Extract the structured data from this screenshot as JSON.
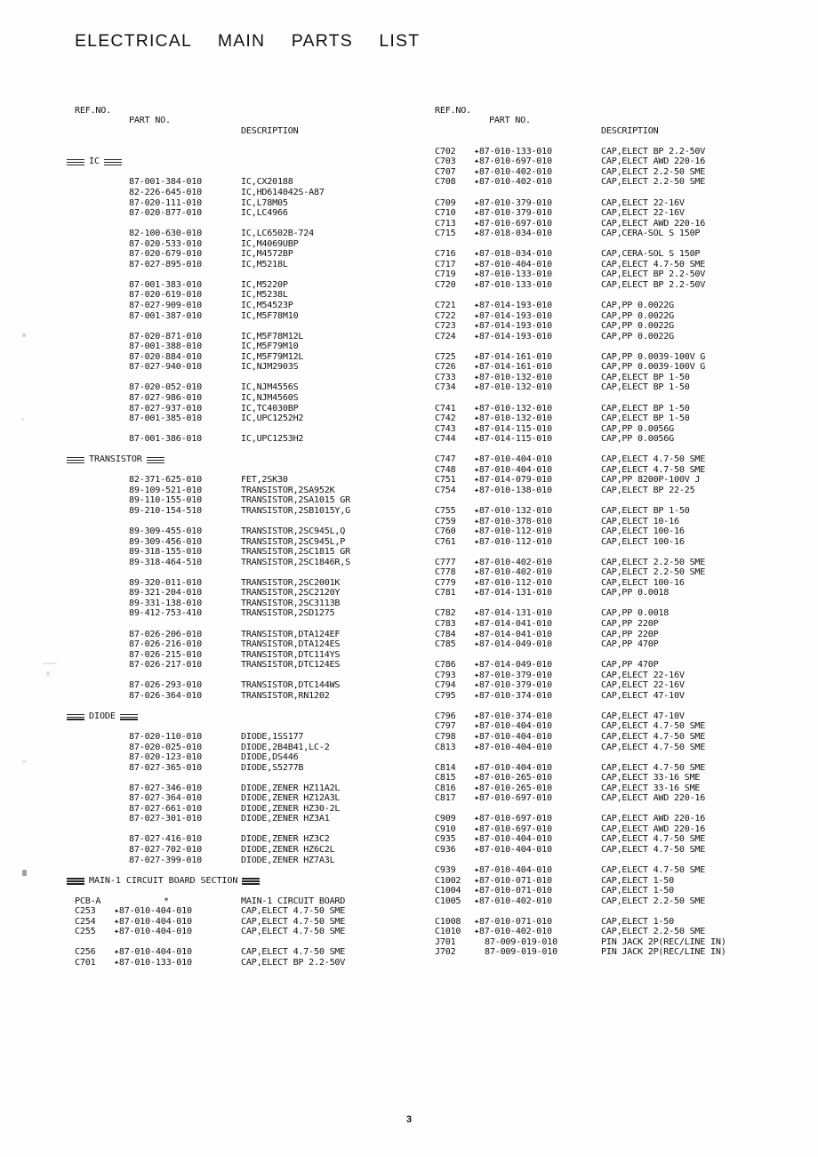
{
  "document": {
    "title": "ELECTRICAL  MAIN  PARTS  LIST",
    "page_number": "3"
  },
  "columns": {
    "headers": {
      "ref_no": "REF.NO.",
      "part_no": "PART NO.",
      "description": "DESCRIPTION"
    }
  },
  "left_column": {
    "blocks": [
      {
        "type": "section",
        "label": "IC"
      },
      {
        "type": "gap"
      },
      {
        "type": "rows",
        "rows": [
          {
            "ref": "",
            "part": "87-001-384-010",
            "desc": "IC,CX20188"
          },
          {
            "ref": "",
            "part": "82-226-645-010",
            "desc": "IC,HD614042S-A87"
          },
          {
            "ref": "",
            "part": "87-020-111-010",
            "desc": "IC,L78M05"
          },
          {
            "ref": "",
            "part": "87-020-877-010",
            "desc": "IC,LC4966"
          }
        ]
      },
      {
        "type": "gap"
      },
      {
        "type": "rows",
        "rows": [
          {
            "ref": "",
            "part": "82-100-630-010",
            "desc": "IC,LC6502B-724"
          },
          {
            "ref": "",
            "part": "87-020-533-010",
            "desc": "IC,M4069UBP"
          },
          {
            "ref": "",
            "part": "87-020-679-010",
            "desc": "IC,M4572BP"
          },
          {
            "ref": "",
            "part": "87-027-895-010",
            "desc": "IC,M5218L"
          }
        ]
      },
      {
        "type": "gap"
      },
      {
        "type": "rows",
        "rows": [
          {
            "ref": "",
            "part": "87-001-383-010",
            "desc": "IC,M5220P"
          },
          {
            "ref": "",
            "part": "87-020-619-010",
            "desc": "IC,M5238L"
          },
          {
            "ref": "",
            "part": "87-027-909-010",
            "desc": "IC,M54523P"
          },
          {
            "ref": "",
            "part": "87-001-387-010",
            "desc": "IC,M5F78M10"
          }
        ]
      },
      {
        "type": "gap"
      },
      {
        "type": "rows",
        "rows": [
          {
            "ref": "",
            "part": "87-020-871-010",
            "desc": "IC,M5F78M12L"
          },
          {
            "ref": "",
            "part": "87-001-388-010",
            "desc": "IC,M5F79M10"
          },
          {
            "ref": "",
            "part": "87-020-884-010",
            "desc": "IC,M5F79M12L"
          },
          {
            "ref": "",
            "part": "87-027-940-010",
            "desc": "IC,NJM2903S"
          }
        ]
      },
      {
        "type": "gap"
      },
      {
        "type": "rows",
        "rows": [
          {
            "ref": "",
            "part": "87-020-052-010",
            "desc": "IC,NJM4556S"
          },
          {
            "ref": "",
            "part": "87-027-986-010",
            "desc": "IC,NJM4560S"
          },
          {
            "ref": "",
            "part": "87-027-937-010",
            "desc": "IC,TC4030BP"
          },
          {
            "ref": "",
            "part": "87-001-385-010",
            "desc": "IC,UPC1252H2"
          }
        ]
      },
      {
        "type": "gap"
      },
      {
        "type": "rows",
        "rows": [
          {
            "ref": "",
            "part": "87-001-386-010",
            "desc": "IC,UPC1253H2"
          }
        ]
      },
      {
        "type": "gap"
      },
      {
        "type": "section",
        "label": "TRANSISTOR"
      },
      {
        "type": "gap"
      },
      {
        "type": "rows",
        "rows": [
          {
            "ref": "",
            "part": "82-371-625-010",
            "desc": "FET,2SK30"
          },
          {
            "ref": "",
            "part": "89-109-521-010",
            "desc": "TRANSISTOR,2SA952K"
          },
          {
            "ref": "",
            "part": "89-110-155-010",
            "desc": "TRANSISTOR,2SA1015 GR"
          },
          {
            "ref": "",
            "part": "89-210-154-510",
            "desc": "TRANSISTOR,2SB1015Y,G"
          }
        ]
      },
      {
        "type": "gap"
      },
      {
        "type": "rows",
        "rows": [
          {
            "ref": "",
            "part": "89-309-455-010",
            "desc": "TRANSISTOR,2SC945L,Q"
          },
          {
            "ref": "",
            "part": "89-309-456-010",
            "desc": "TRANSISTOR,2SC945L,P"
          },
          {
            "ref": "",
            "part": "89-318-155-010",
            "desc": "TRANSISTOR,2SC1815 GR"
          },
          {
            "ref": "",
            "part": "89-318-464-510",
            "desc": "TRANSISTOR,2SC1846R,S"
          }
        ]
      },
      {
        "type": "gap"
      },
      {
        "type": "rows",
        "rows": [
          {
            "ref": "",
            "part": "89-320-011-010",
            "desc": "TRANSISTOR,2SC2001K"
          },
          {
            "ref": "",
            "part": "89-321-204-010",
            "desc": "TRANSISTOR,2SC2120Y"
          },
          {
            "ref": "",
            "part": "89-331-138-010",
            "desc": "TRANSISTOR,2SC3113B"
          },
          {
            "ref": "",
            "part": "89-412-753-410",
            "desc": "TRANSISTOR,2SD1275"
          }
        ]
      },
      {
        "type": "gap"
      },
      {
        "type": "rows",
        "rows": [
          {
            "ref": "",
            "part": "87-026-206-010",
            "desc": "TRANSISTOR,DTA124EF"
          },
          {
            "ref": "",
            "part": "87-026-216-010",
            "desc": "TRANSISTOR,DTA124ES"
          },
          {
            "ref": "",
            "part": "87-026-215-010",
            "desc": "TRANSISTOR,DTC114YS"
          },
          {
            "ref": "",
            "part": "87-026-217-010",
            "desc": "TRANSISTOR,DTC124ES"
          }
        ]
      },
      {
        "type": "gap"
      },
      {
        "type": "rows",
        "rows": [
          {
            "ref": "",
            "part": "87-026-293-010",
            "desc": "TRANSISTOR,DTC144WS"
          },
          {
            "ref": "",
            "part": "87-026-364-010",
            "desc": "TRANSISTOR,RN1202"
          }
        ]
      },
      {
        "type": "gap"
      },
      {
        "type": "section",
        "label": "DIODE"
      },
      {
        "type": "gap"
      },
      {
        "type": "rows",
        "rows": [
          {
            "ref": "",
            "part": "87-020-110-010",
            "desc": "DIODE,1SS177"
          },
          {
            "ref": "",
            "part": "87-020-025-010",
            "desc": "DIODE,2B4B41,LC-2"
          },
          {
            "ref": "",
            "part": "87-020-123-010",
            "desc": "DIODE,DS446"
          },
          {
            "ref": "",
            "part": "87-027-365-010",
            "desc": "DIODE,S5277B"
          }
        ]
      },
      {
        "type": "gap"
      },
      {
        "type": "rows",
        "rows": [
          {
            "ref": "",
            "part": "87-027-346-010",
            "desc": "DIODE,ZENER HZ11A2L"
          },
          {
            "ref": "",
            "part": "87-027-364-010",
            "desc": "DIODE,ZENER HZ12A3L"
          },
          {
            "ref": "",
            "part": "87-027-661-010",
            "desc": "DIODE,ZENER HZ30-2L"
          },
          {
            "ref": "",
            "part": "87-027-301-010",
            "desc": "DIODE,ZENER HZ3A1"
          }
        ]
      },
      {
        "type": "gap"
      },
      {
        "type": "rows",
        "rows": [
          {
            "ref": "",
            "part": "87-027-416-010",
            "desc": "DIODE,ZENER HZ3C2"
          },
          {
            "ref": "",
            "part": "87-027-702-010",
            "desc": "DIODE,ZENER HZ6C2L"
          },
          {
            "ref": "",
            "part": "87-027-399-010",
            "desc": "DIODE,ZENER HZ7A3L"
          }
        ]
      },
      {
        "type": "gap"
      },
      {
        "type": "section",
        "label": "MAIN-1 CIRCUIT BOARD SECTION"
      },
      {
        "type": "gap"
      },
      {
        "type": "rows",
        "rows": [
          {
            "ref": "PCB-A",
            "part": "*",
            "desc": "MAIN-1 CIRCUIT BOARD",
            "part_center": true
          },
          {
            "ref": "C253",
            "part": "✦87-010-404-010",
            "desc": "CAP,ELECT 4.7-50 SME"
          },
          {
            "ref": "C254",
            "part": "✦87-010-404-010",
            "desc": "CAP,ELECT 4.7-50 SME"
          },
          {
            "ref": "C255",
            "part": "✦87-010-404-010",
            "desc": "CAP,ELECT 4.7-50 SME"
          }
        ]
      },
      {
        "type": "gap"
      },
      {
        "type": "rows",
        "rows": [
          {
            "ref": "C256",
            "part": "✦87-010-404-010",
            "desc": "CAP,ELECT 4.7-50 SME"
          },
          {
            "ref": "C701",
            "part": "✦87-010-133-010",
            "desc": "CAP,ELECT BP 2.2-50V"
          }
        ]
      }
    ]
  },
  "right_column": {
    "blocks": [
      {
        "type": "gap"
      },
      {
        "type": "gap"
      },
      {
        "type": "rows",
        "rows": [
          {
            "ref": "C702",
            "part": "✦87-010-133-010",
            "desc": "CAP,ELECT BP 2.2-50V"
          },
          {
            "ref": "C703",
            "part": "✦87-010-697-010",
            "desc": "CAP,ELECT AWD 220-16"
          },
          {
            "ref": "C707",
            "part": "✦87-010-402-010",
            "desc": "CAP,ELECT 2.2-50 SME"
          },
          {
            "ref": "C708",
            "part": "✦87-010-402-010",
            "desc": "CAP,ELECT 2.2-50 SME"
          }
        ]
      },
      {
        "type": "gap"
      },
      {
        "type": "rows",
        "rows": [
          {
            "ref": "C709",
            "part": "✦87-010-379-010",
            "desc": "CAP,ELECT 22-16V"
          },
          {
            "ref": "C710",
            "part": "✦87-010-379-010",
            "desc": "CAP,ELECT 22-16V"
          },
          {
            "ref": "C713",
            "part": "✦87-010-697-010",
            "desc": "CAP,ELECT AWD 220-16"
          },
          {
            "ref": "C715",
            "part": "✦87-018-034-010",
            "desc": "CAP,CERA-SOL S 150P"
          }
        ]
      },
      {
        "type": "gap"
      },
      {
        "type": "rows",
        "rows": [
          {
            "ref": "C716",
            "part": "✦87-018-034-010",
            "desc": "CAP,CERA-SOL S 150P"
          },
          {
            "ref": "C717",
            "part": "✦87-010-404-010",
            "desc": "CAP,ELECT 4.7-50 SME"
          },
          {
            "ref": "C719",
            "part": "✦87-010-133-010",
            "desc": "CAP,ELECT BP 2.2-50V"
          },
          {
            "ref": "C720",
            "part": "✦87-010-133-010",
            "desc": "CAP,ELECT BP 2.2-50V"
          }
        ]
      },
      {
        "type": "gap"
      },
      {
        "type": "rows",
        "rows": [
          {
            "ref": "C721",
            "part": "✦87-014-193-010",
            "desc": "CAP,PP 0.0022G"
          },
          {
            "ref": "C722",
            "part": "✦87-014-193-010",
            "desc": "CAP,PP 0.0022G"
          },
          {
            "ref": "C723",
            "part": "✦87-014-193-010",
            "desc": "CAP,PP 0.0022G"
          },
          {
            "ref": "C724",
            "part": "✦87-014-193-010",
            "desc": "CAP,PP 0.0022G"
          }
        ]
      },
      {
        "type": "gap"
      },
      {
        "type": "rows",
        "rows": [
          {
            "ref": "C725",
            "part": "✦87-014-161-010",
            "desc": "CAP,PP 0.0039-100V G"
          },
          {
            "ref": "C726",
            "part": "✦87-014-161-010",
            "desc": "CAP,PP 0.0039-100V G"
          },
          {
            "ref": "C733",
            "part": "✦87-010-132-010",
            "desc": "CAP,ELECT BP 1-50"
          },
          {
            "ref": "C734",
            "part": "✦87-010-132-010",
            "desc": "CAP,ELECT BP 1-50"
          }
        ]
      },
      {
        "type": "gap"
      },
      {
        "type": "rows",
        "rows": [
          {
            "ref": "C741",
            "part": "✦87-010-132-010",
            "desc": "CAP,ELECT BP 1-50"
          },
          {
            "ref": "C742",
            "part": "✦87-010-132-010",
            "desc": "CAP,ELECT BP 1-50"
          },
          {
            "ref": "C743",
            "part": "✦87-014-115-010",
            "desc": "CAP,PP 0.0056G"
          },
          {
            "ref": "C744",
            "part": "✦87-014-115-010",
            "desc": "CAP,PP 0.0056G"
          }
        ]
      },
      {
        "type": "gap"
      },
      {
        "type": "rows",
        "rows": [
          {
            "ref": "C747",
            "part": "✦87-010-404-010",
            "desc": "CAP,ELECT 4.7-50 SME"
          },
          {
            "ref": "C748",
            "part": "✦87-010-404-010",
            "desc": "CAP,ELECT 4.7-50 SME"
          },
          {
            "ref": "C751",
            "part": "✦87-014-079-010",
            "desc": "CAP,PP 8200P-100V J"
          },
          {
            "ref": "C754",
            "part": "✦87-010-138-010",
            "desc": "CAP,ELECT BP 22-25"
          }
        ]
      },
      {
        "type": "gap"
      },
      {
        "type": "rows",
        "rows": [
          {
            "ref": "C755",
            "part": "✦87-010-132-010",
            "desc": "CAP,ELECT BP 1-50"
          },
          {
            "ref": "C759",
            "part": "✦87-010-378-010",
            "desc": "CAP,ELECT 10-16"
          },
          {
            "ref": "C760",
            "part": "✦87-010-112-010",
            "desc": "CAP,ELECT 100-16"
          },
          {
            "ref": "C761",
            "part": "✦87-010-112-010",
            "desc": "CAP,ELECT 100-16"
          }
        ]
      },
      {
        "type": "gap"
      },
      {
        "type": "rows",
        "rows": [
          {
            "ref": "C777",
            "part": "✦87-010-402-010",
            "desc": "CAP,ELECT 2.2-50 SME"
          },
          {
            "ref": "C778",
            "part": "✦87-010-402-010",
            "desc": "CAP,ELECT 2.2-50 SME"
          },
          {
            "ref": "C779",
            "part": "✦87-010-112-010",
            "desc": "CAP,ELECT 100-16"
          },
          {
            "ref": "C781",
            "part": "✦87-014-131-010",
            "desc": "CAP,PP 0.0018"
          }
        ]
      },
      {
        "type": "gap"
      },
      {
        "type": "rows",
        "rows": [
          {
            "ref": "C782",
            "part": "✦87-014-131-010",
            "desc": "CAP,PP 0.0018"
          },
          {
            "ref": "C783",
            "part": "✦87-014-041-010",
            "desc": "CAP,PP 220P"
          },
          {
            "ref": "C784",
            "part": "✦87-014-041-010",
            "desc": "CAP,PP 220P"
          },
          {
            "ref": "C785",
            "part": "✦87-014-049-010",
            "desc": "CAP,PP 470P"
          }
        ]
      },
      {
        "type": "gap"
      },
      {
        "type": "rows",
        "rows": [
          {
            "ref": "C786",
            "part": "✦87-014-049-010",
            "desc": "CAP,PP 470P"
          },
          {
            "ref": "C793",
            "part": "✦87-010-379-010",
            "desc": "CAP,ELECT 22-16V"
          },
          {
            "ref": "C794",
            "part": "✦87-010-379-010",
            "desc": "CAP,ELECT 22-16V"
          },
          {
            "ref": "C795",
            "part": "✦87-010-374-010",
            "desc": "CAP,ELECT 47-10V"
          }
        ]
      },
      {
        "type": "gap"
      },
      {
        "type": "rows",
        "rows": [
          {
            "ref": "C796",
            "part": "✦87-010-374-010",
            "desc": "CAP,ELECT 47-10V"
          },
          {
            "ref": "C797",
            "part": "✦87-010-404-010",
            "desc": "CAP,ELECT 4.7-50 SME"
          },
          {
            "ref": "C798",
            "part": "✦87-010-404-010",
            "desc": "CAP,ELECT 4.7-50 SME"
          },
          {
            "ref": "C813",
            "part": "✦87-010-404-010",
            "desc": "CAP,ELECT 4.7-50 SME"
          }
        ]
      },
      {
        "type": "gap"
      },
      {
        "type": "rows",
        "rows": [
          {
            "ref": "C814",
            "part": "✦87-010-404-010",
            "desc": "CAP,ELECT 4.7-50 SME"
          },
          {
            "ref": "C815",
            "part": "✦87-010-265-010",
            "desc": "CAP,ELECT 33-16 SME"
          },
          {
            "ref": "C816",
            "part": "✦87-010-265-010",
            "desc": "CAP,ELECT 33-16 SME"
          },
          {
            "ref": "C817",
            "part": "✦87-010-697-010",
            "desc": "CAP,ELECT AWD 220-16"
          }
        ]
      },
      {
        "type": "gap"
      },
      {
        "type": "rows",
        "rows": [
          {
            "ref": "C909",
            "part": "✦87-010-697-010",
            "desc": "CAP,ELECT AWD 220-16"
          },
          {
            "ref": "C910",
            "part": "✦87-010-697-010",
            "desc": "CAP,ELECT AWD 220-16"
          },
          {
            "ref": "C935",
            "part": "✦87-010-404-010",
            "desc": "CAP,ELECT 4.7-50 SME"
          },
          {
            "ref": "C936",
            "part": "✦87-010-404-010",
            "desc": "CAP,ELECT 4.7-50 SME"
          }
        ]
      },
      {
        "type": "gap"
      },
      {
        "type": "rows",
        "rows": [
          {
            "ref": "C939",
            "part": "✦87-010-404-010",
            "desc": "CAP,ELECT 4.7-50 SME"
          },
          {
            "ref": "C1002",
            "part": "✦87-010-071-010",
            "desc": "CAP,ELECT 1-50"
          },
          {
            "ref": "C1004",
            "part": "✦87-010-071-010",
            "desc": "CAP,ELECT 1-50"
          },
          {
            "ref": "C1005",
            "part": "✦87-010-402-010",
            "desc": "CAP,ELECT 2.2-50 SME"
          }
        ]
      },
      {
        "type": "gap"
      },
      {
        "type": "rows",
        "rows": [
          {
            "ref": "C1008",
            "part": "✦87-010-071-010",
            "desc": "CAP,ELECT 1-50"
          },
          {
            "ref": "C1010",
            "part": "✦87-010-402-010",
            "desc": "CAP,ELECT 2.2-50 SME"
          },
          {
            "ref": "J701",
            "part": "87-009-019-010",
            "desc": "PIN JACK 2P(REC/LINE IN)",
            "no_star": true
          },
          {
            "ref": "J702",
            "part": "87-009-019-010",
            "desc": "PIN JACK 2P(REC/LINE IN)",
            "no_star": true
          }
        ]
      }
    ]
  }
}
